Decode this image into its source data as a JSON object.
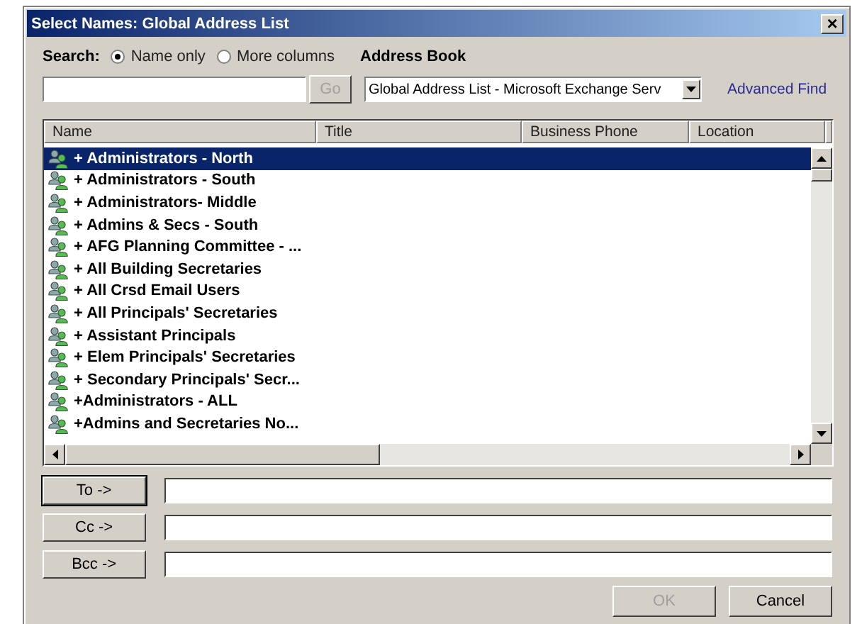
{
  "window": {
    "title": "Select Names: Global Address List",
    "close": "×"
  },
  "search": {
    "label": "Search:",
    "options": [
      {
        "label": "Name only",
        "selected": true
      },
      {
        "label": "More columns",
        "selected": false
      }
    ],
    "go_button": "Go",
    "go_disabled": true
  },
  "address_book": {
    "label": "Address Book",
    "value": "Global Address List - Microsoft Exchange Serv",
    "advanced_find": "Advanced Find"
  },
  "table": {
    "columns": [
      "Name",
      "Title",
      "Business Phone",
      "Location"
    ],
    "rows": [
      {
        "name": "+ Administrators - North",
        "selected": true
      },
      {
        "name": "+ Administrators - South",
        "selected": false
      },
      {
        "name": "+ Administrators- Middle",
        "selected": false
      },
      {
        "name": "+ Admins & Secs - South",
        "selected": false
      },
      {
        "name": "+ AFG Planning Committee - ...",
        "selected": false
      },
      {
        "name": "+ All Building Secretaries",
        "selected": false
      },
      {
        "name": "+ All Crsd Email Users",
        "selected": false
      },
      {
        "name": "+ All Principals' Secretaries",
        "selected": false
      },
      {
        "name": "+ Assistant Principals",
        "selected": false
      },
      {
        "name": "+ Elem Principals' Secretaries",
        "selected": false
      },
      {
        "name": "+ Secondary Principals' Secr...",
        "selected": false
      },
      {
        "name": "+Administrators - ALL",
        "selected": false
      },
      {
        "name": "+Admins and Secretaries No...",
        "selected": false
      }
    ]
  },
  "recipients": [
    {
      "button": "To ->",
      "default": true
    },
    {
      "button": "Cc ->",
      "default": false
    },
    {
      "button": "Bcc ->",
      "default": false
    }
  ],
  "buttons": [
    {
      "label": "OK",
      "disabled": true
    },
    {
      "label": "Cancel",
      "disabled": false
    }
  ]
}
